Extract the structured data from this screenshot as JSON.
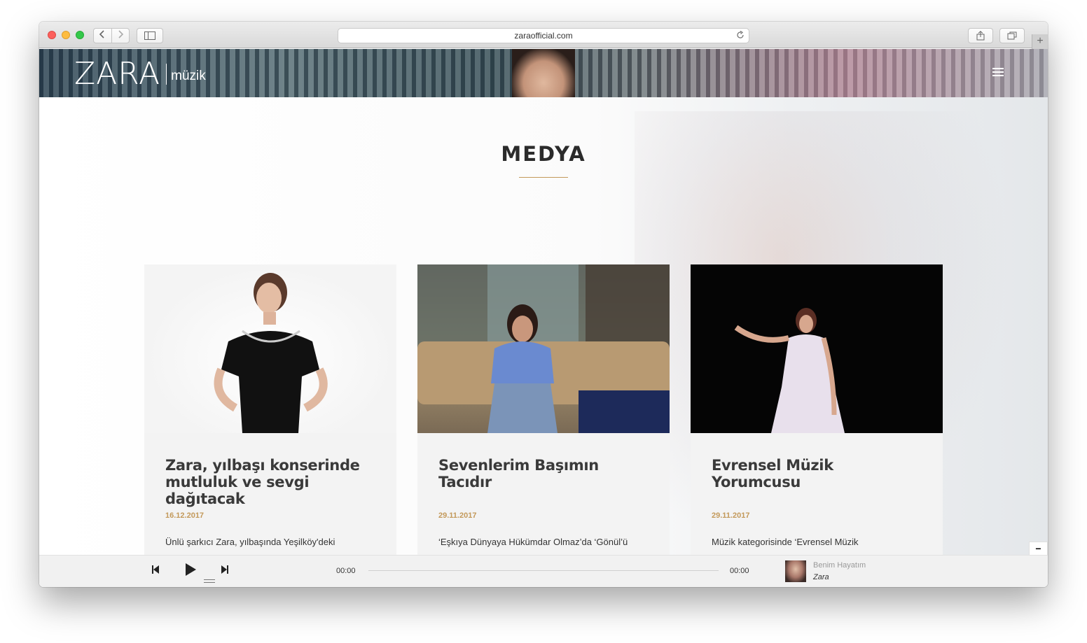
{
  "browser": {
    "url": "zaraofficial.com",
    "back_icon": "chevron-left-icon",
    "forward_icon": "chevron-right-icon",
    "new_tab": "+"
  },
  "site": {
    "logo_main": "ZARA",
    "logo_sub": "müzik",
    "section_title": "MEDYA",
    "accent_color": "#c3995a"
  },
  "cards": [
    {
      "title": "Zara, yılbaşı konserinde mutluluk ve sevgi dağıtacak",
      "date": "16.12.2017",
      "excerpt": "Ünlü şarkıcı Zara, yılbaşında Yeşilköy'deki"
    },
    {
      "title": "Sevenlerim Başımın Tacıdır",
      "date": "29.11.2017",
      "excerpt": "‘Eşkıya Dünyaya Hükümdar Olmaz’da ‘Gönül’ü"
    },
    {
      "title": "Evrensel Müzik Yorumcusu",
      "date": "29.11.2017",
      "excerpt": "Müzik kategorisinde ‘Evrensel Müzik"
    }
  ],
  "player": {
    "current_time": "00:00",
    "duration": "00:00",
    "song": "Benim Hayatım",
    "artist": "Zara",
    "progress": 0,
    "collapse_label": "−"
  }
}
